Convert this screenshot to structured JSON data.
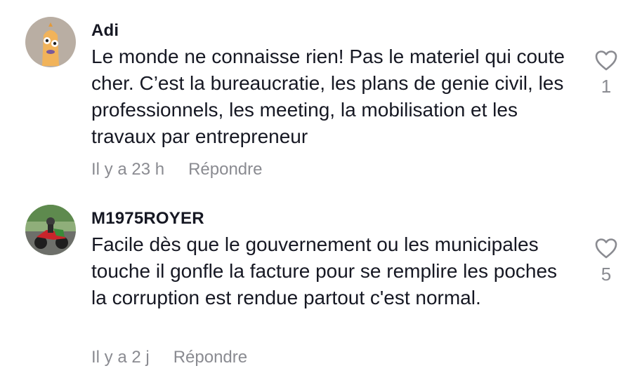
{
  "comments": [
    {
      "username": "Adi",
      "text": "Le monde ne connaisse rien! Pas le materiel qui coute cher. C’est la bureaucratie, les plans de genie civil, les professionnels, les meeting, la mobilisation et les travaux par entrepreneur",
      "time": "Il y a 23 h",
      "reply_label": "Répondre",
      "likes": "1"
    },
    {
      "username": "M1975ROYER",
      "text": "Facile dès que le gouvernement ou les municipales touche il gonfle la facture pour se remplire les poches la corruption est rendue partout c'est normal.",
      "time": "Il y a 2 j",
      "reply_label": "Répondre",
      "likes": "5"
    }
  ],
  "icons": {
    "like": "heart-outline-icon"
  },
  "colors": {
    "text": "#161823",
    "muted": "#8a8b91"
  }
}
